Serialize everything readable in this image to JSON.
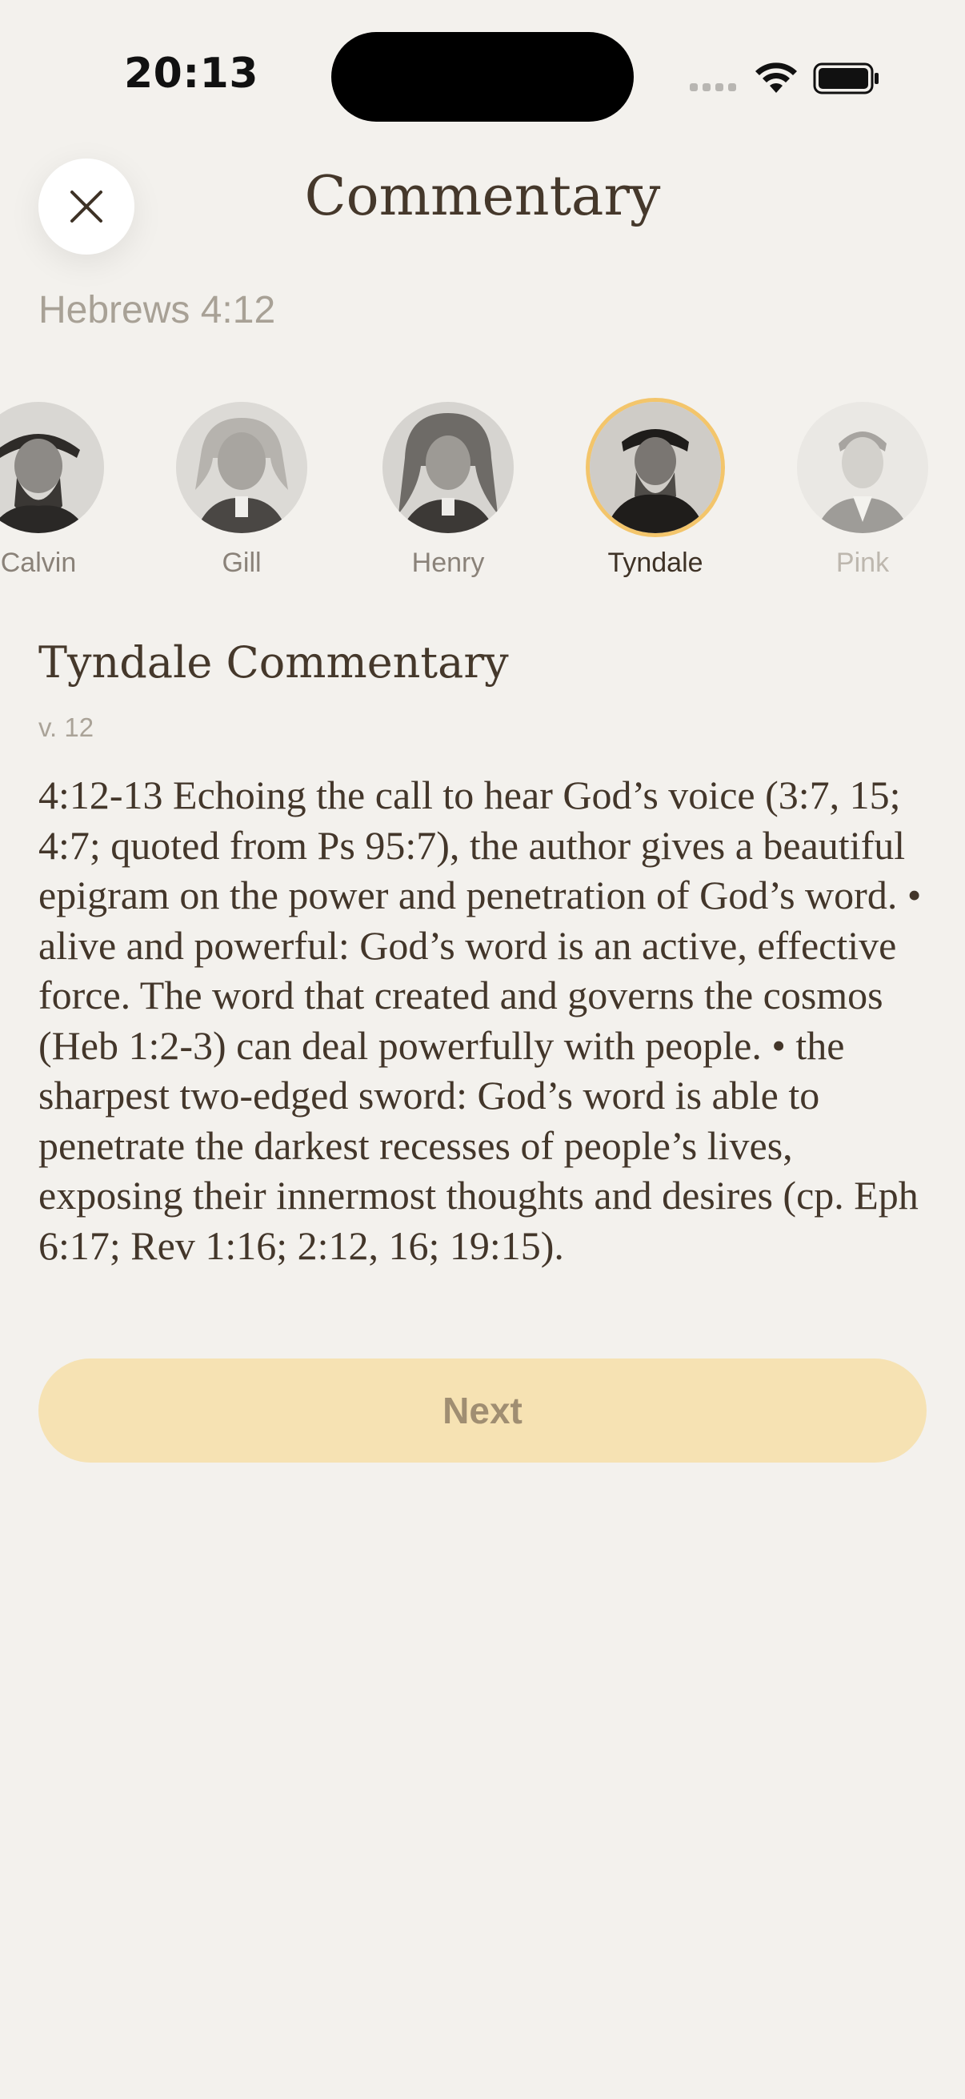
{
  "status_bar": {
    "time": "20:13"
  },
  "header": {
    "title": "Commentary",
    "close_icon": "close-icon"
  },
  "verse_reference": "Hebrews 4:12",
  "commentators": [
    {
      "name": "Calvin",
      "state": "normal"
    },
    {
      "name": "Gill",
      "state": "normal"
    },
    {
      "name": "Henry",
      "state": "normal"
    },
    {
      "name": "Tyndale",
      "state": "selected"
    },
    {
      "name": "Pink",
      "state": "faded"
    }
  ],
  "commentary": {
    "title": "Tyndale Commentary",
    "verse_label": "v. 12",
    "text": "4:12-13 Echoing the call to hear God’s voice (3:7, 15; 4:7; quoted from Ps 95:7), the author gives a beautiful epigram on the power and penetration of God’s word. • alive and powerful: God’s word is an active, effective force. The word that created and governs the cosmos (Heb 1:2-3) can deal powerfully with people. • the sharpest two-edged sword: God’s word is able to penetrate the darkest recesses of people’s lives, exposing their innermost thoughts and desires (cp. Eph 6:17; Rev 1:16; 2:12, 16; 19:15)."
  },
  "next_button": {
    "label": "Next"
  },
  "colors": {
    "background": "#f3f1ed",
    "accent": "#f3c56b",
    "button_fill": "#f6e2b3",
    "text": "#45382b"
  }
}
